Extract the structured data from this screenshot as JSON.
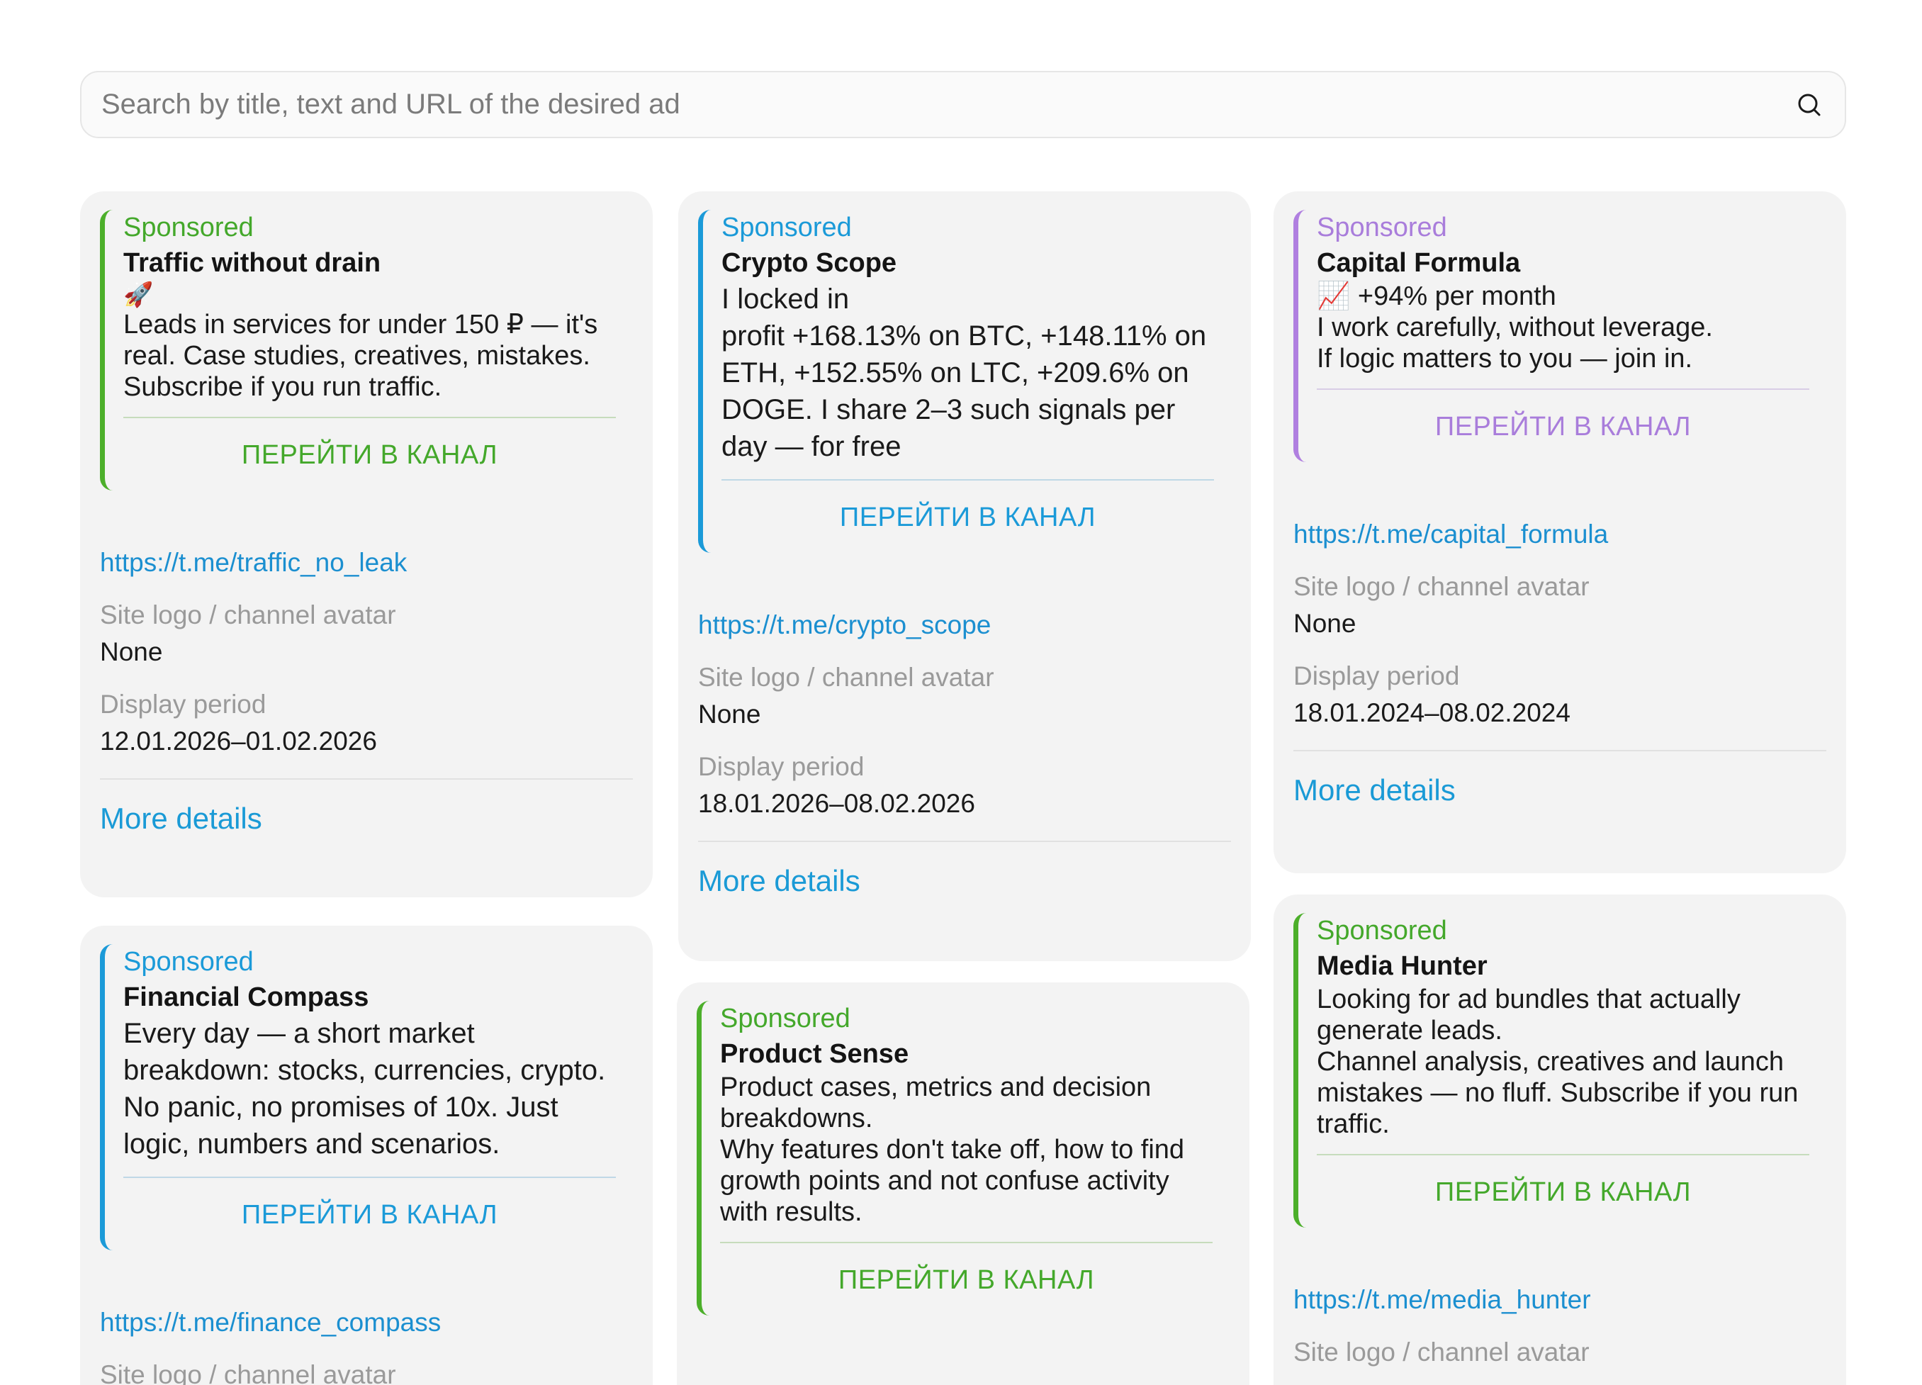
{
  "search": {
    "placeholder": "Search by title, text and URL of the desired ad"
  },
  "labels": {
    "logo_label": "Site logo / channel avatar",
    "period_label": "Display period",
    "more": "More details",
    "cta": "ПЕРЕЙТИ В КАНАЛ",
    "sponsored": "Sponsored"
  },
  "cards": [
    {
      "title": "Traffic without drain",
      "emoji": "🚀",
      "body": "Leads in services for under 150 ₽ — it's real. Case studies, creatives, mistakes. Subscribe if you run traffic.",
      "url": "https://t.me/traffic_no_leak",
      "logo": "None",
      "period": "12.01.2026–01.02.2026",
      "accent": "#44a82b"
    },
    {
      "title": "Crypto Scope",
      "body": "I locked in\nprofit +168.13% on BTC, +148.11% on ETH, +152.55% on LTC, +209.6% on DOGE. I share 2–3 such signals per day — for free",
      "url": "https://t.me/crypto_scope",
      "logo": "None",
      "period": "18.01.2026–08.02.2026",
      "accent": "#1b9ad8"
    },
    {
      "title": "Capital Formula",
      "emoji_line": "📈 +94% per month",
      "body": "I work carefully, without leverage.\nIf logic matters to you — join in.",
      "url": "https://t.me/capital_formula",
      "logo": "None",
      "period": "18.01.2024–08.02.2024",
      "accent": "#a97ddb"
    },
    {
      "title": "Financial Compass",
      "body": "Every day — a short market breakdown: stocks, currencies, crypto. No panic, no promises of 10x. Just logic, numbers and scenarios.",
      "url": "https://t.me/finance_compass",
      "logo_label_partial": "Site logo / channel avatar",
      "accent": "#1b9ad8"
    },
    {
      "title": "Product Sense",
      "body": "Product cases, metrics and decision breakdowns.\nWhy features don't take off, how to find growth points and not confuse activity with results.",
      "accent": "#44a82b"
    },
    {
      "title": "Media Hunter",
      "body": "Looking for ad bundles that actually generate leads.\nChannel analysis, creatives and launch mistakes — no fluff. Subscribe if you run traffic.",
      "url": "https://t.me/media_hunter",
      "accent": "#44a82b"
    }
  ]
}
